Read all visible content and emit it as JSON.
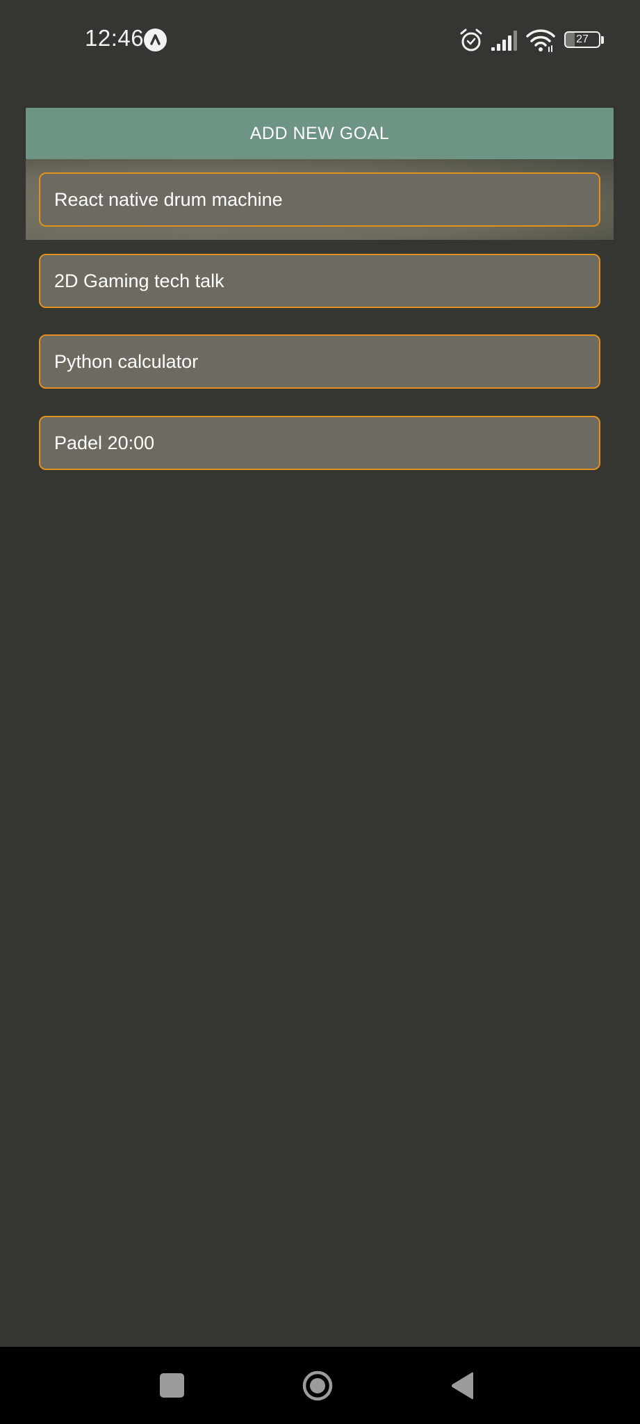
{
  "status_bar": {
    "time": "12:46",
    "battery_percent": "27",
    "icons": [
      "app-badge-icon",
      "alarm-icon",
      "signal-icon",
      "wifi-icon",
      "battery-icon"
    ]
  },
  "main": {
    "add_button_label": "ADD NEW GOAL",
    "goals": [
      "React native drum machine",
      "2D Gaming tech talk",
      "Python calculator",
      "Padel 20:00"
    ]
  },
  "nav_bar": {
    "icons": [
      "recents-icon",
      "home-icon",
      "back-icon"
    ]
  },
  "colors": {
    "background": "#353531",
    "button": "#6e9483",
    "goal_fill": "#6c6a61",
    "goal_border": "#e2921c",
    "nav_bar": "#000000"
  }
}
